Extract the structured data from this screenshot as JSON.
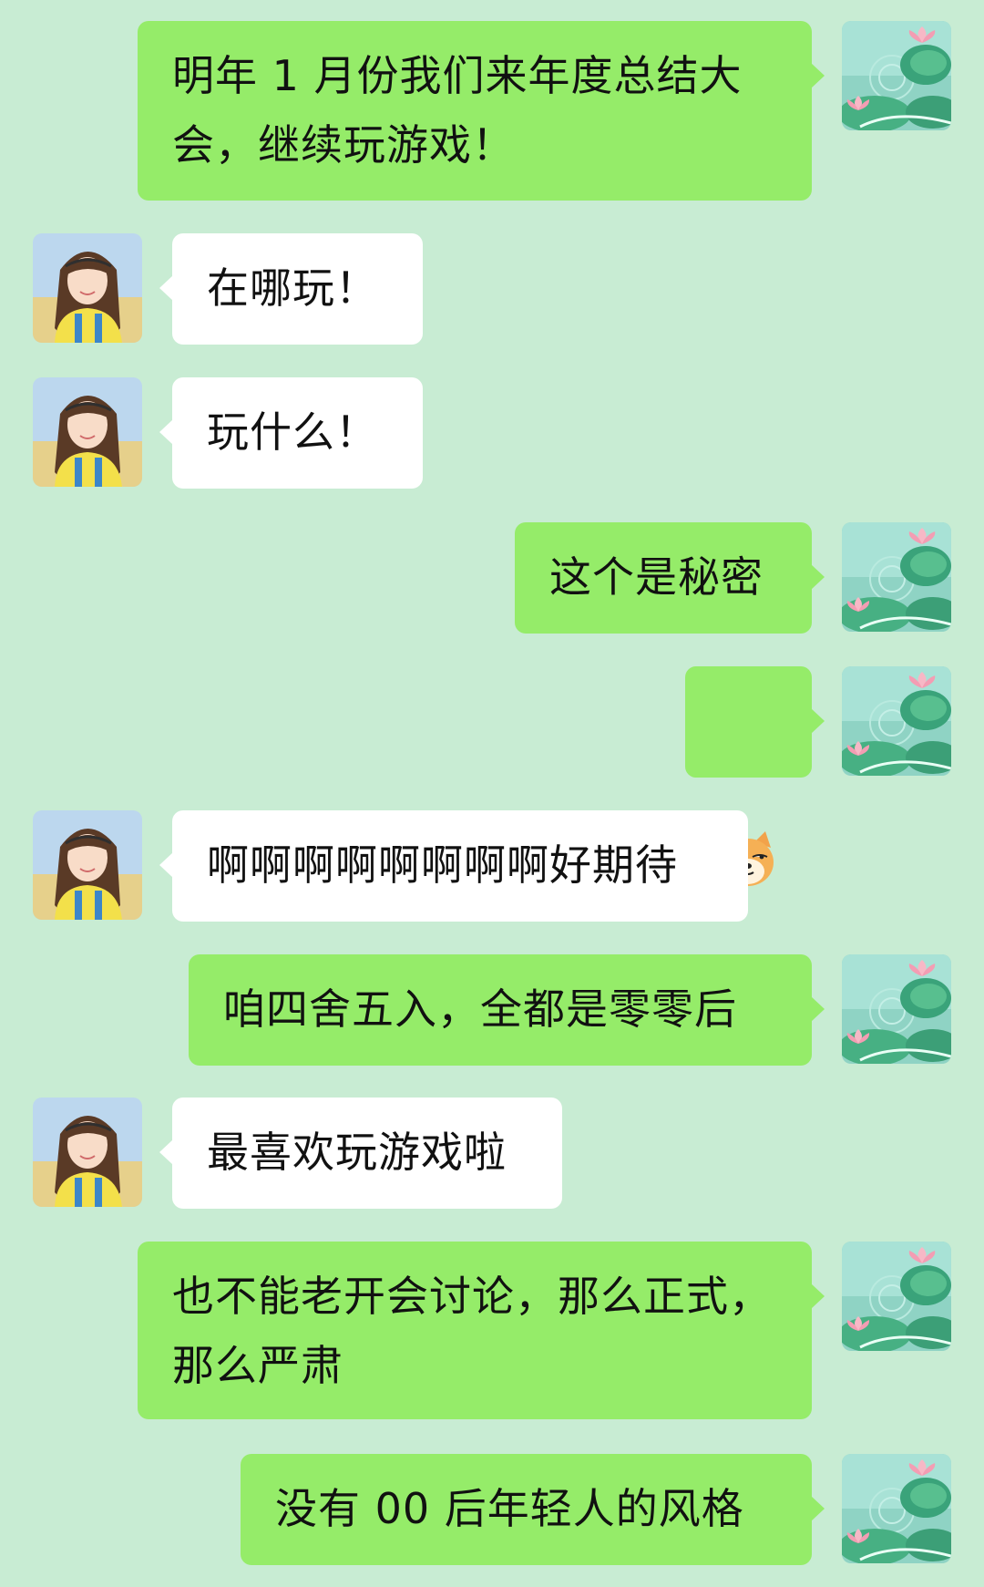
{
  "messages": [
    {
      "side": "mine",
      "text": "明年 1 月份我们来年度总结大\n会，继续玩游戏！"
    },
    {
      "side": "theirs",
      "text": "在哪玩！"
    },
    {
      "side": "theirs",
      "text": "玩什么！"
    },
    {
      "side": "mine",
      "text": "这个是秘密"
    },
    {
      "side": "mine",
      "emoji": "doge-emoji"
    },
    {
      "side": "theirs",
      "text": "啊啊啊啊啊啊啊啊好期待"
    },
    {
      "side": "mine",
      "text": "咱四舍五入，全都是零零后"
    },
    {
      "side": "theirs",
      "text": "最喜欢玩游戏啦"
    },
    {
      "side": "mine",
      "text": "也不能老开会讨论，那么正式，\n那么严肃"
    },
    {
      "side": "mine",
      "text": "没有 00 后年轻人的风格"
    }
  ],
  "colors": {
    "background": "#c8ecd3",
    "mine_bubble": "#95ec69",
    "theirs_bubble": "#ffffff"
  },
  "icons": {
    "my_avatar": "lotus-pond-avatar",
    "their_avatar": "girl-portrait-avatar",
    "emoji": "doge-emoji"
  }
}
